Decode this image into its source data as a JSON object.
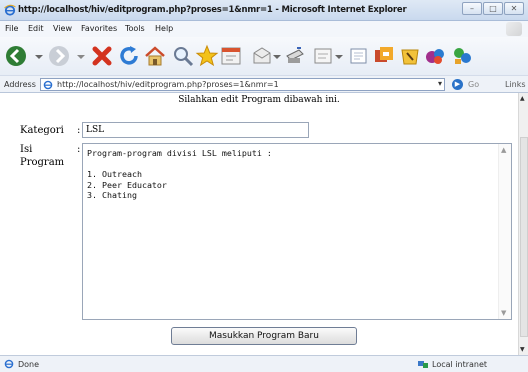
{
  "window": {
    "title": "http://localhost/hiv/editprogram.php?proses=1&nmr=1 - Microsoft Internet Explorer",
    "buttons": {
      "minimize": "–",
      "maximize": "□",
      "close": "✕"
    }
  },
  "menu": {
    "items": [
      "File",
      "Edit",
      "View",
      "Favorites",
      "Tools",
      "Help"
    ]
  },
  "toolbar": {
    "icons": [
      "back-icon",
      "forward-icon",
      "stop-icon",
      "refresh-icon",
      "home-icon",
      "search-icon",
      "favorites-icon",
      "history-icon",
      "mail-icon",
      "print-icon",
      "edit-icon",
      "discuss-icon",
      "messenger-icon",
      "research-icon",
      "media-icon",
      "msn-icon"
    ]
  },
  "address": {
    "label": "Address",
    "url": "http://localhost/hiv/editprogram.php?proses=1&nmr=1",
    "go_label": "Go",
    "links_label": "Links"
  },
  "page": {
    "heading": "Silahkan edit Program dibawah ini.",
    "kategori_label": "Kategori",
    "colon": ":",
    "kategori_value": "LSL",
    "isi_label_1": "Isi",
    "isi_label_2": "Program",
    "program_text": "Program-program divisi LSL meliputi :\n\n1. Outreach\n2. Peer Educator\n3. Chating",
    "submit_label": "Masukkan Program Baru"
  },
  "status": {
    "text": "Done",
    "zone": "Local intranet"
  },
  "colors": {
    "title_gradient_top": "#dfe9f5",
    "title_gradient_bottom": "#c9d9ee",
    "go_blue": "#2a72c8"
  }
}
